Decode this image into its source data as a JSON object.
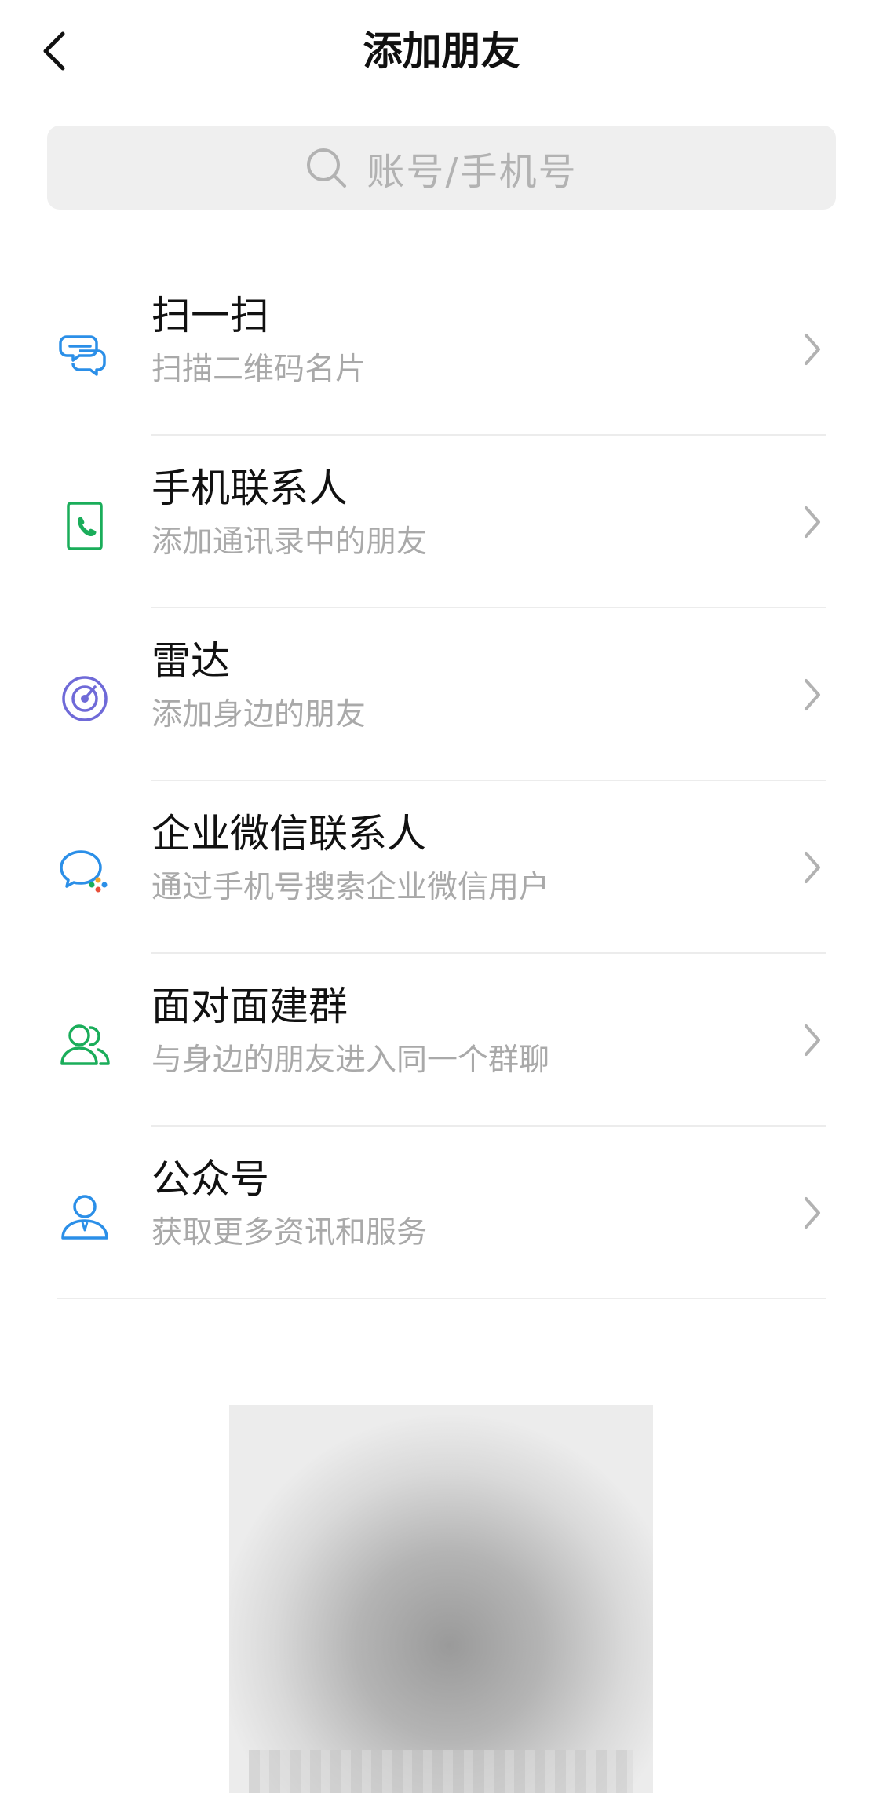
{
  "header": {
    "title": "添加朋友",
    "back_icon": "chevron-left-icon"
  },
  "search": {
    "placeholder": "账号/手机号",
    "icon": "search-icon"
  },
  "items": [
    {
      "label": "扫一扫",
      "desc": "扫描二维码名片",
      "icon": "scan-icon",
      "color": "#2B8FE8"
    },
    {
      "label": "手机联系人",
      "desc": "添加通讯录中的朋友",
      "icon": "phone-contact-icon",
      "color": "#1AAD5A"
    },
    {
      "label": "雷达",
      "desc": "添加身边的朋友",
      "icon": "radar-icon",
      "color": "#6F6AD8"
    },
    {
      "label": "企业微信联系人",
      "desc": "通过手机号搜索企业微信用户",
      "icon": "wecom-icon",
      "color": "#2B8FE8"
    },
    {
      "label": "面对面建群",
      "desc": "与身边的朋友进入同一个群聊",
      "icon": "group-icon",
      "color": "#1AAD5A"
    },
    {
      "label": "公众号",
      "desc": "获取更多资讯和服务",
      "icon": "official-account-icon",
      "color": "#2B8FE8"
    }
  ],
  "qr_code": {
    "icon": "qr-code-icon"
  }
}
